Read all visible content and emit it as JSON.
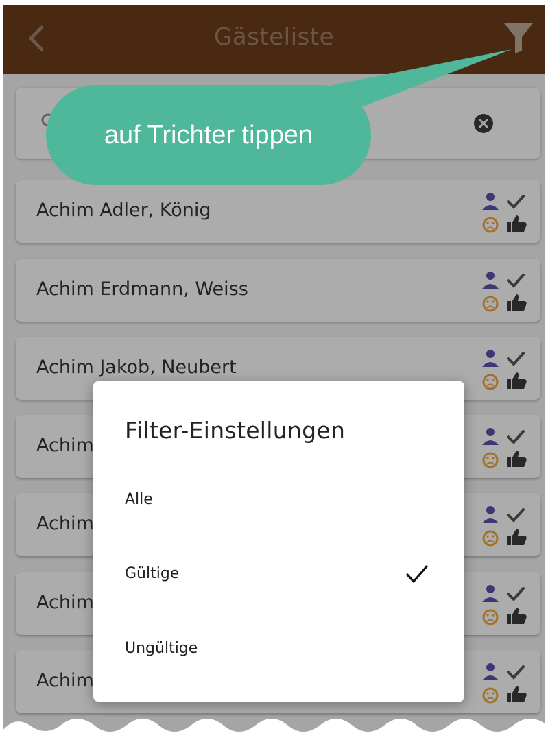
{
  "header": {
    "title": "Gästeliste",
    "back_icon": "chevron-left-icon",
    "filter_icon": "funnel-icon",
    "bar_color": "#6a3c1c"
  },
  "search": {
    "search_icon": "search-icon",
    "clear_icon": "clear-circle-icon"
  },
  "guests": [
    {
      "name": "Achim Adler, König"
    },
    {
      "name": "Achim Erdmann, Weiss"
    },
    {
      "name": "Achim Jakob, Neubert"
    },
    {
      "name": "Achim"
    },
    {
      "name": "Achim"
    },
    {
      "name": "Achim"
    },
    {
      "name": "Achim"
    }
  ],
  "guest_status_icons": [
    "person-icon",
    "check-icon",
    "sad-face-icon",
    "thumbs-up-icon"
  ],
  "tooltip": {
    "text": "auf Trichter tippen",
    "color": "#4fb89b"
  },
  "dialog": {
    "title": "Filter-Einstellungen",
    "options": [
      {
        "label": "Alle",
        "selected": false
      },
      {
        "label": "Gültige",
        "selected": true
      },
      {
        "label": "Ungültige",
        "selected": false
      }
    ]
  }
}
